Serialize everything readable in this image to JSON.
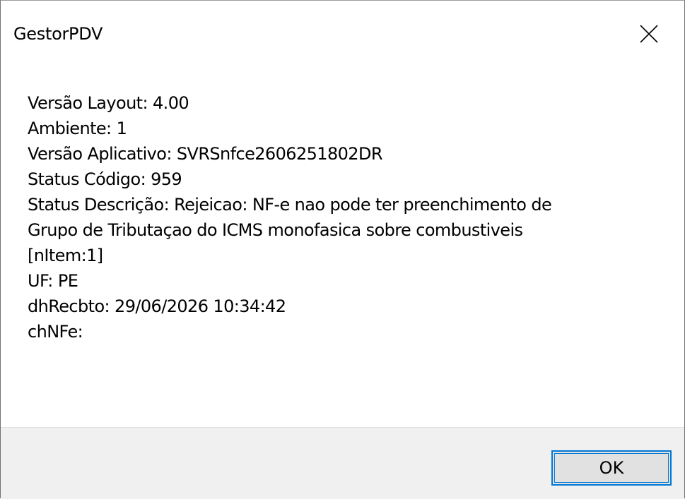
{
  "window": {
    "title": "GestorPDV",
    "close_icon": "close-x-icon"
  },
  "message": {
    "lines": [
      "Versão Layout: 4.00",
      "Ambiente: 1",
      "Versão Aplicativo: SVRSnfce2606251802DR",
      "Status Código: 959",
      "Status Descrição: Rejeicao: NF-e nao pode ter preenchimento de",
      "Grupo de Tributaçao do ICMS monofasica sobre combustiveis",
      "[nItem:1]",
      "UF: PE",
      "dhRecbto: 29/06/2026 10:34:42",
      "chNFe:"
    ]
  },
  "buttons": {
    "ok_label": "OK"
  },
  "colors": {
    "accent": "#0078d7",
    "footer_bg": "#f0f0f0",
    "button_bg": "#e1e1e1"
  }
}
